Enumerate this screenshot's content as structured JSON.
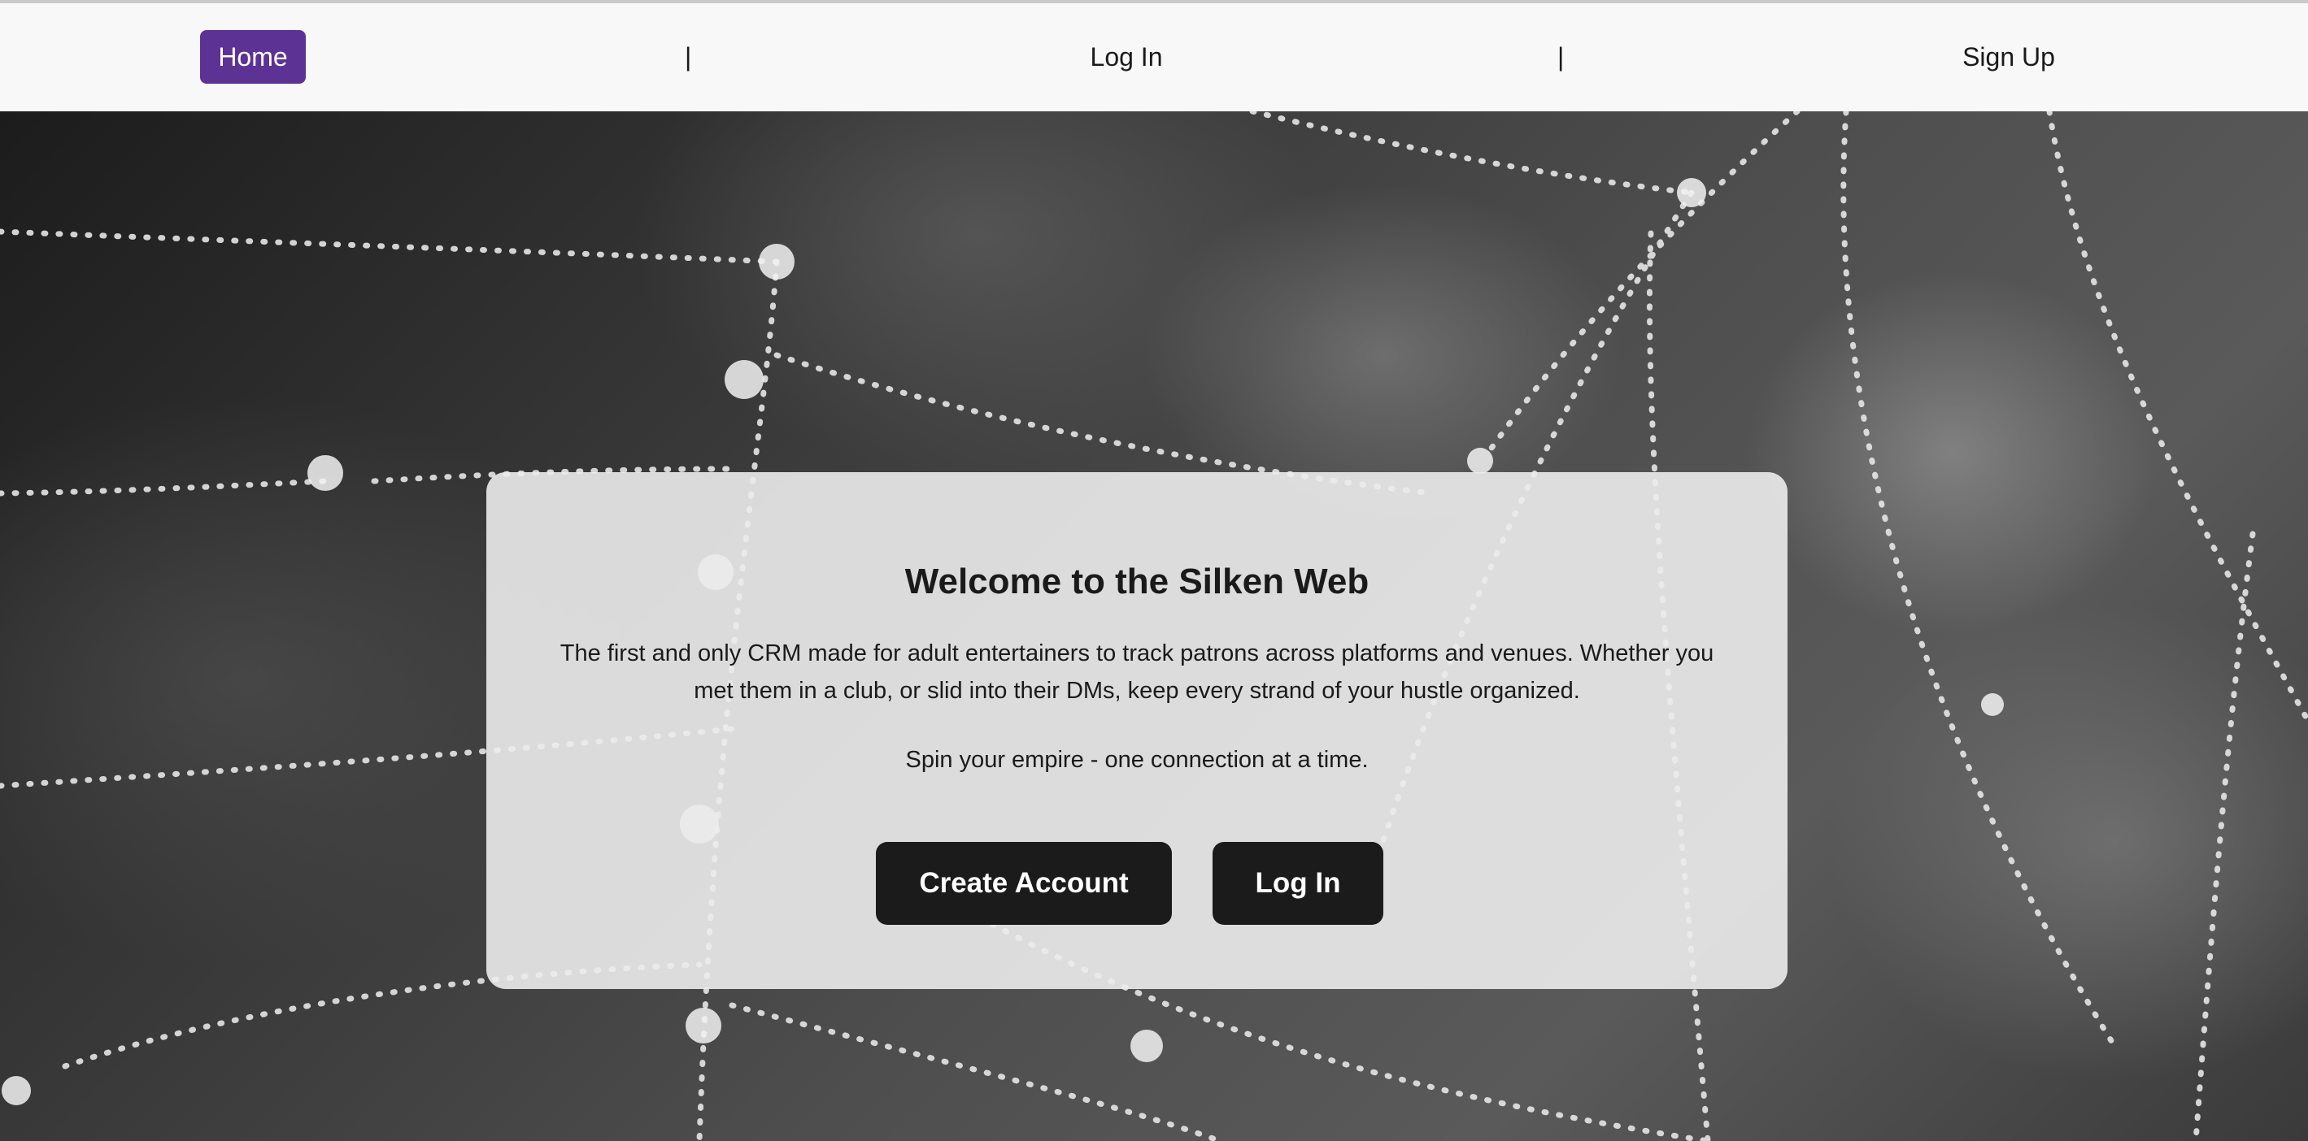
{
  "nav": {
    "home_label": "Home",
    "login_label": "Log In",
    "signup_label": "Sign Up",
    "separator": "|"
  },
  "hero": {
    "title": "Welcome to the Silken Web",
    "description": "The first and only CRM made for adult entertainers to track patrons across platforms and venues. Whether you met them in a club, or slid into their DMs, keep every strand of your hustle organized.",
    "tagline": "Spin your empire - one connection at a time.",
    "create_account_label": "Create Account",
    "login_label": "Log In"
  },
  "colors": {
    "accent": "#5c3394",
    "button_dark": "#1b1b1b",
    "navbar_bg": "#f8f8f8"
  }
}
